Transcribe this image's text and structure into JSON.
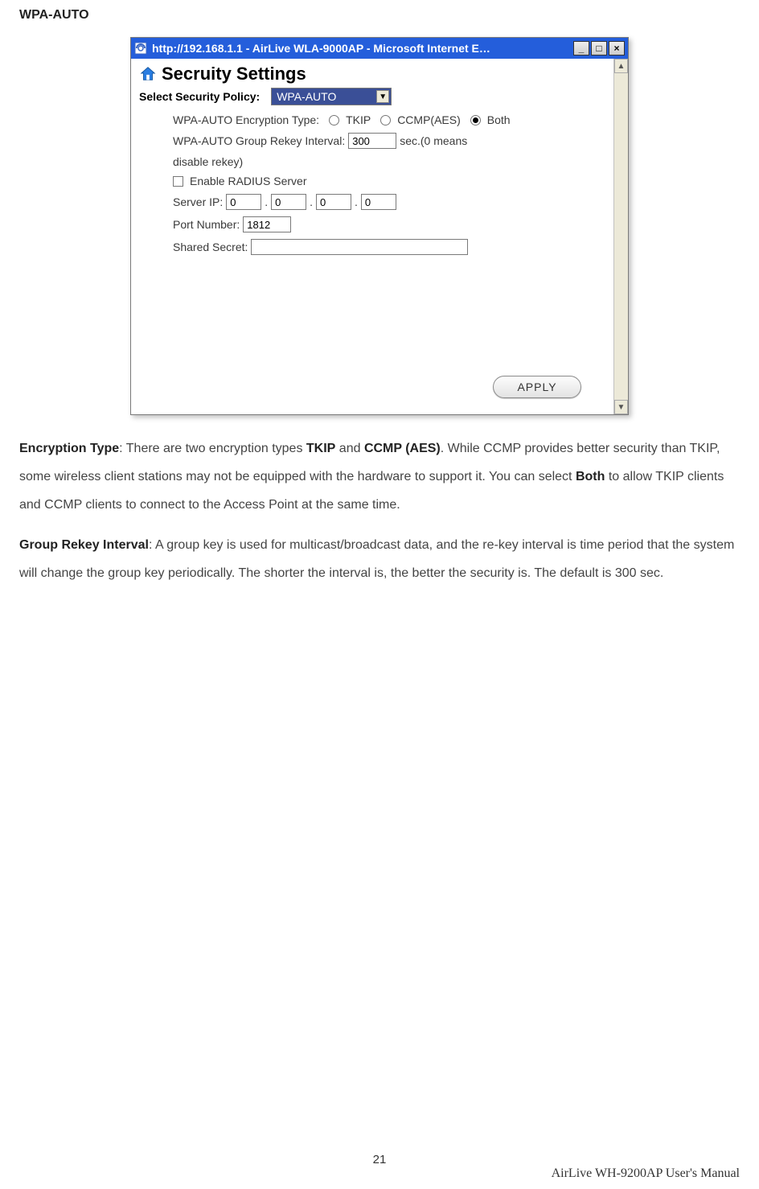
{
  "section_heading": "WPA-AUTO",
  "window": {
    "title": "http://192.168.1.1 - AirLive WLA-9000AP - Microsoft Internet E…",
    "heading": "Secruity Settings",
    "policy_label": "Select Security Policy:",
    "policy_value": "WPA-AUTO",
    "encryption_label": "WPA-AUTO Encryption Type:",
    "radio_tkip": "TKIP",
    "radio_ccmp": "CCMP(AES)",
    "radio_both": "Both",
    "rekey_label_a": "WPA-AUTO Group Rekey Interval:",
    "rekey_value": "300",
    "rekey_label_b": "sec.(0 means",
    "rekey_label_c": "disable rekey)",
    "enable_radius": "Enable RADIUS Server",
    "server_ip_label": "Server IP:",
    "ip1": "0",
    "ip2": "0",
    "ip3": "0",
    "ip4": "0",
    "port_label": "Port Number:",
    "port_value": "1812",
    "secret_label": "Shared Secret:",
    "secret_value": "",
    "apply": "APPLY"
  },
  "paragraphs": {
    "p1_a": "Encryption Type",
    "p1_b": ": There are two encryption types ",
    "p1_c": "TKIP",
    "p1_d": " and ",
    "p1_e": "CCMP (AES)",
    "p1_f": ". While CCMP provides better security than TKIP, some wireless client stations may not be equipped with the hardware to support it. You can select ",
    "p1_g": "Both",
    "p1_h": " to allow TKIP clients and CCMP clients to connect to the Access Point at the same time.",
    "p2_a": "Group Rekey Interval",
    "p2_b": ": A group key is used for multicast/broadcast data, and the re-key interval is time period that the system will change the group key periodically. The shorter the interval is, the better the security is. The default is 300 sec."
  },
  "footer": {
    "page_number": "21",
    "manual": "AirLive WH-9200AP User's Manual"
  }
}
